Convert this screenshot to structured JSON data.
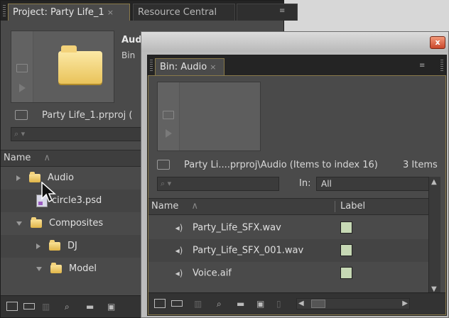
{
  "project": {
    "tab_active": "Project: Party Life_1",
    "tab_close": "×",
    "tab_inactive": "Resource Central",
    "menu_icon": "≡",
    "preview": {
      "title": "Aud",
      "subtitle": "Bin"
    },
    "path": "Party Life_1.prproj (",
    "search_glyph": "⌕ ▾",
    "column_name": "Name",
    "sort_glyph": "∧",
    "rows": [
      {
        "label": "Audio",
        "kind": "folder",
        "state": "collapsed",
        "indent": 0
      },
      {
        "label": "circle3.psd",
        "kind": "psd",
        "state": "none",
        "indent": 0
      },
      {
        "label": "Composites",
        "kind": "folder",
        "state": "expanded",
        "indent": 0
      },
      {
        "label": "DJ",
        "kind": "folder",
        "state": "collapsed",
        "indent": 1
      },
      {
        "label": "Model",
        "kind": "folder",
        "state": "expanded",
        "indent": 1
      }
    ],
    "bottom_icons": [
      "list-view-icon",
      "icon-view-icon",
      "automate-icon",
      "find-icon",
      "new-bin-icon",
      "new-item-icon"
    ]
  },
  "bin_window": {
    "close_glyph": "x",
    "tab": "Bin: Audio",
    "tab_close": "×",
    "menu_icon": "≡",
    "path": "Party Li....prproj\\Audio (Items to index 16)",
    "item_count": "3 Items",
    "search_glyph": "⌕ ▾",
    "in_label": "In:",
    "in_value": "All",
    "column_name": "Name",
    "sort_glyph": "∧",
    "column_label": "Label",
    "items": [
      {
        "name": "Party_Life_SFX.wav",
        "label_color": "#c7d9b5"
      },
      {
        "name": "Party_Life_SFX_001.wav",
        "label_color": "#c7d9b5"
      },
      {
        "name": "Voice.aif",
        "label_color": "#c7d9b5"
      }
    ],
    "scroll_up": "▲",
    "scroll_down": "▼",
    "scroll_left": "◀",
    "scroll_right": "▶"
  },
  "colors": {
    "panel_bg": "#4a4a4a",
    "tab_highlight": "#8a7a4a",
    "label_swatch": "#c7d9b5",
    "folder": "#f3d27a",
    "close_button": "#c9472b"
  }
}
